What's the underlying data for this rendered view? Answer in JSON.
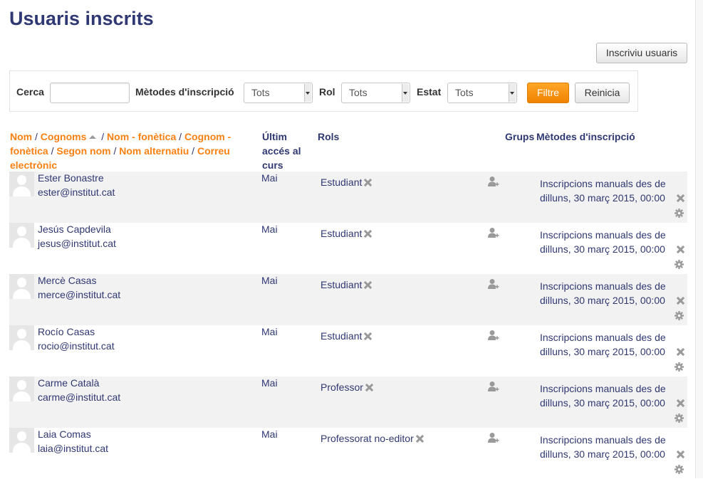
{
  "page": {
    "title": "Usuaris inscrits"
  },
  "toolbar": {
    "enrol_label": "Inscriviu usuaris"
  },
  "filters": {
    "search_label": "Cerca",
    "search_value": "",
    "methods_label": "Mètodes d'inscripció",
    "methods_value": "Tots",
    "role_label": "Rol",
    "role_value": "Tots",
    "status_label": "Estat",
    "status_value": "Tots",
    "filter_button": "Filtre",
    "reset_button": "Reinicia"
  },
  "table": {
    "sort_links": {
      "first_name": "Nom",
      "last_name": "Cognoms",
      "first_phonetic": "Nom - fonètica",
      "last_phonetic": "Cognom - fonètica",
      "middle_name": "Segon nom",
      "alternate_name": "Nom alternatiu",
      "email": "Correu electrònic",
      "separator": " / "
    },
    "headers": {
      "last_access": "Últim accés al curs",
      "roles": "Rols",
      "groups": "Grups",
      "methods": "Mètodes d'inscripció"
    },
    "rows": [
      {
        "name": "Ester Bonastre",
        "email": "ester@institut.cat",
        "last_access": "Mai",
        "role": "Estudiant",
        "method": "Inscripcions manuals des de dilluns, 30 març 2015, 00:00"
      },
      {
        "name": "Jesús Capdevila",
        "email": "jesus@institut.cat",
        "last_access": "Mai",
        "role": "Estudiant",
        "method": "Inscripcions manuals des de dilluns, 30 març 2015, 00:00"
      },
      {
        "name": "Mercè Casas",
        "email": "merce@institut.cat",
        "last_access": "Mai",
        "role": "Estudiant",
        "method": "Inscripcions manuals des de dilluns, 30 març 2015, 00:00"
      },
      {
        "name": "Rocío Casas",
        "email": "rocio@institut.cat",
        "last_access": "Mai",
        "role": "Estudiant",
        "method": "Inscripcions manuals des de dilluns, 30 març 2015, 00:00"
      },
      {
        "name": "Carme Català",
        "email": "carme@institut.cat",
        "last_access": "Mai",
        "role": "Professor",
        "method": "Inscripcions manuals des de dilluns, 30 març 2015, 00:00"
      },
      {
        "name": "Laia Comas",
        "email": "laia@institut.cat",
        "last_access": "Mai",
        "role": "Professorat no-editor",
        "method": "Inscripcions manuals des de dilluns, 30 març 2015, 00:00"
      }
    ]
  },
  "icons": {
    "remove_role": "close-icon",
    "add_group": "add-user-icon",
    "unenrol": "close-icon",
    "edit_enrolment": "gear-icon",
    "sort": "caret-up-icon"
  },
  "colors": {
    "heading": "#2f3873",
    "link": "#f98012",
    "filter_button": "#f98012",
    "row_stripe": "#f2f2f2"
  }
}
